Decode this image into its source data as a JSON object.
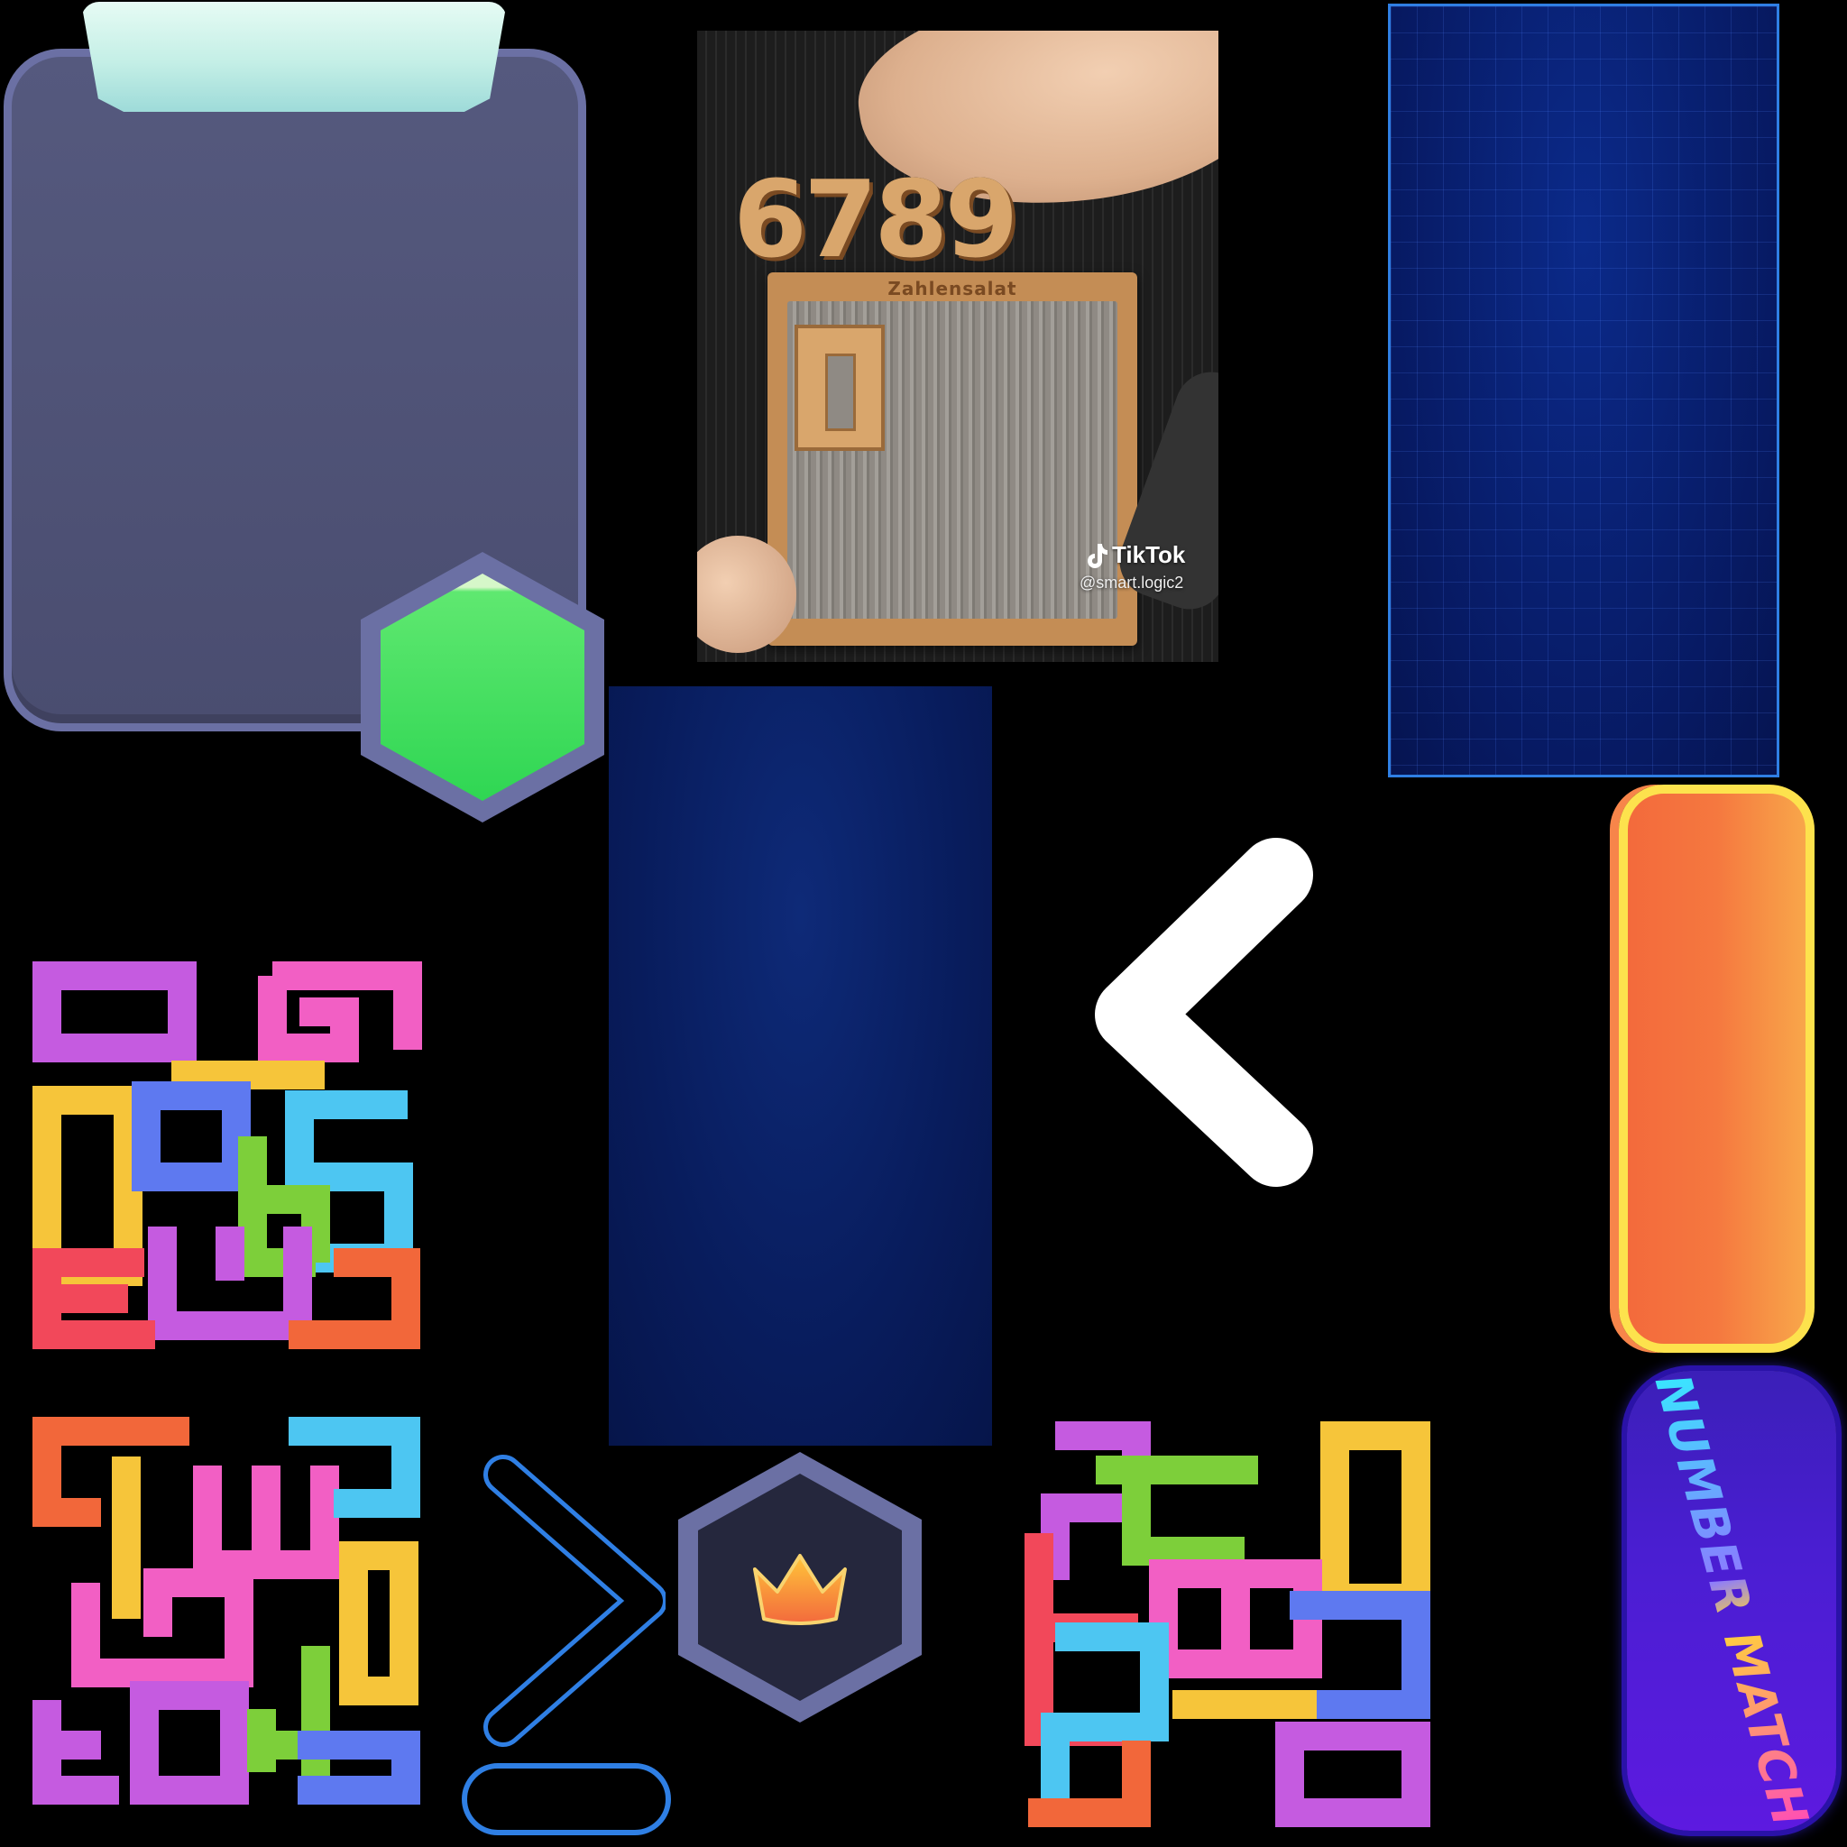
{
  "video": {
    "board_label": "Zahlensalat",
    "digits_text": "6789",
    "platform_label": "TikTok",
    "handle": "@smart.logic2"
  },
  "logo": {
    "text": "NUMBER MATCH"
  },
  "icons": {
    "back": "chevron-left-icon",
    "forward": "chevron-right-icon",
    "crown": "crown-icon",
    "play": "green-hexagon-icon"
  },
  "colors": {
    "panel": "#55597e",
    "panel_border": "#6b70a4",
    "green": "#3cd85c",
    "orange": "#f5783f",
    "yellow_border": "#fde24d",
    "grid_blue": "#0b2a8a",
    "dark_blue": "#081c5c",
    "piece_purple": "#c55be0",
    "piece_pink": "#f25fc4",
    "piece_yellow": "#f6c53a",
    "piece_blue": "#5e79f0",
    "piece_cyan": "#4dc6f2",
    "piece_green": "#7dcf3a",
    "piece_red": "#f2485a",
    "piece_orange": "#f2673a"
  }
}
